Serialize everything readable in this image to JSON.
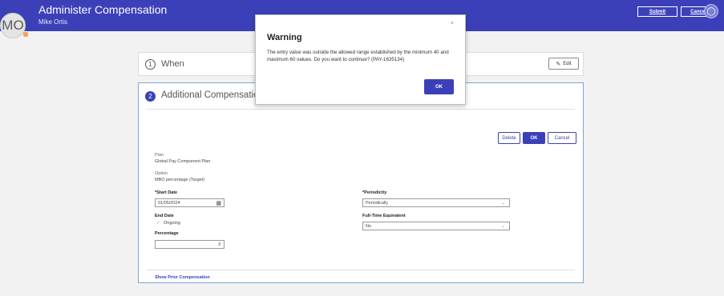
{
  "header": {
    "title": "Administer Compensation",
    "user_name": "Mike Ortis",
    "avatar_initials": "MO",
    "submit_label": "Submit",
    "cancel_label": "Cancel"
  },
  "when_section": {
    "step_number": "1",
    "title": "When",
    "edit_label": "Edit"
  },
  "additional_section": {
    "step_number": "2",
    "title": "Additional Compensation",
    "delete_label": "Delete",
    "ok_label": "OK",
    "cancel_label": "Cancel",
    "plan_label": "Plan",
    "plan_value": "Global Pay Component Plan",
    "option_label": "Option",
    "option_value": "MBO percentage (Target)",
    "start_date_label": "*Start Date",
    "start_date_value": "01/05/2024",
    "end_date_label": "End Date",
    "ongoing_label": "Ongoing",
    "percentage_label": "Percentage",
    "percentage_value": "3",
    "periodicity_label": "*Periodicity",
    "periodicity_value": "Periodically",
    "fte_label": "Full-Time Equivalent",
    "fte_value": "No",
    "show_prior_label": "Show Prior Compensation"
  },
  "dialog": {
    "title": "Warning",
    "message": "The entry value was outside the allowed range established by the minimum 40 and maximum 60 values. Do you want to continue? (PAY-1635134)",
    "ok_label": "OK",
    "close_glyph": "×"
  },
  "colors": {
    "brand": "#3c40b8",
    "accent_border": "#7aa7d8"
  }
}
